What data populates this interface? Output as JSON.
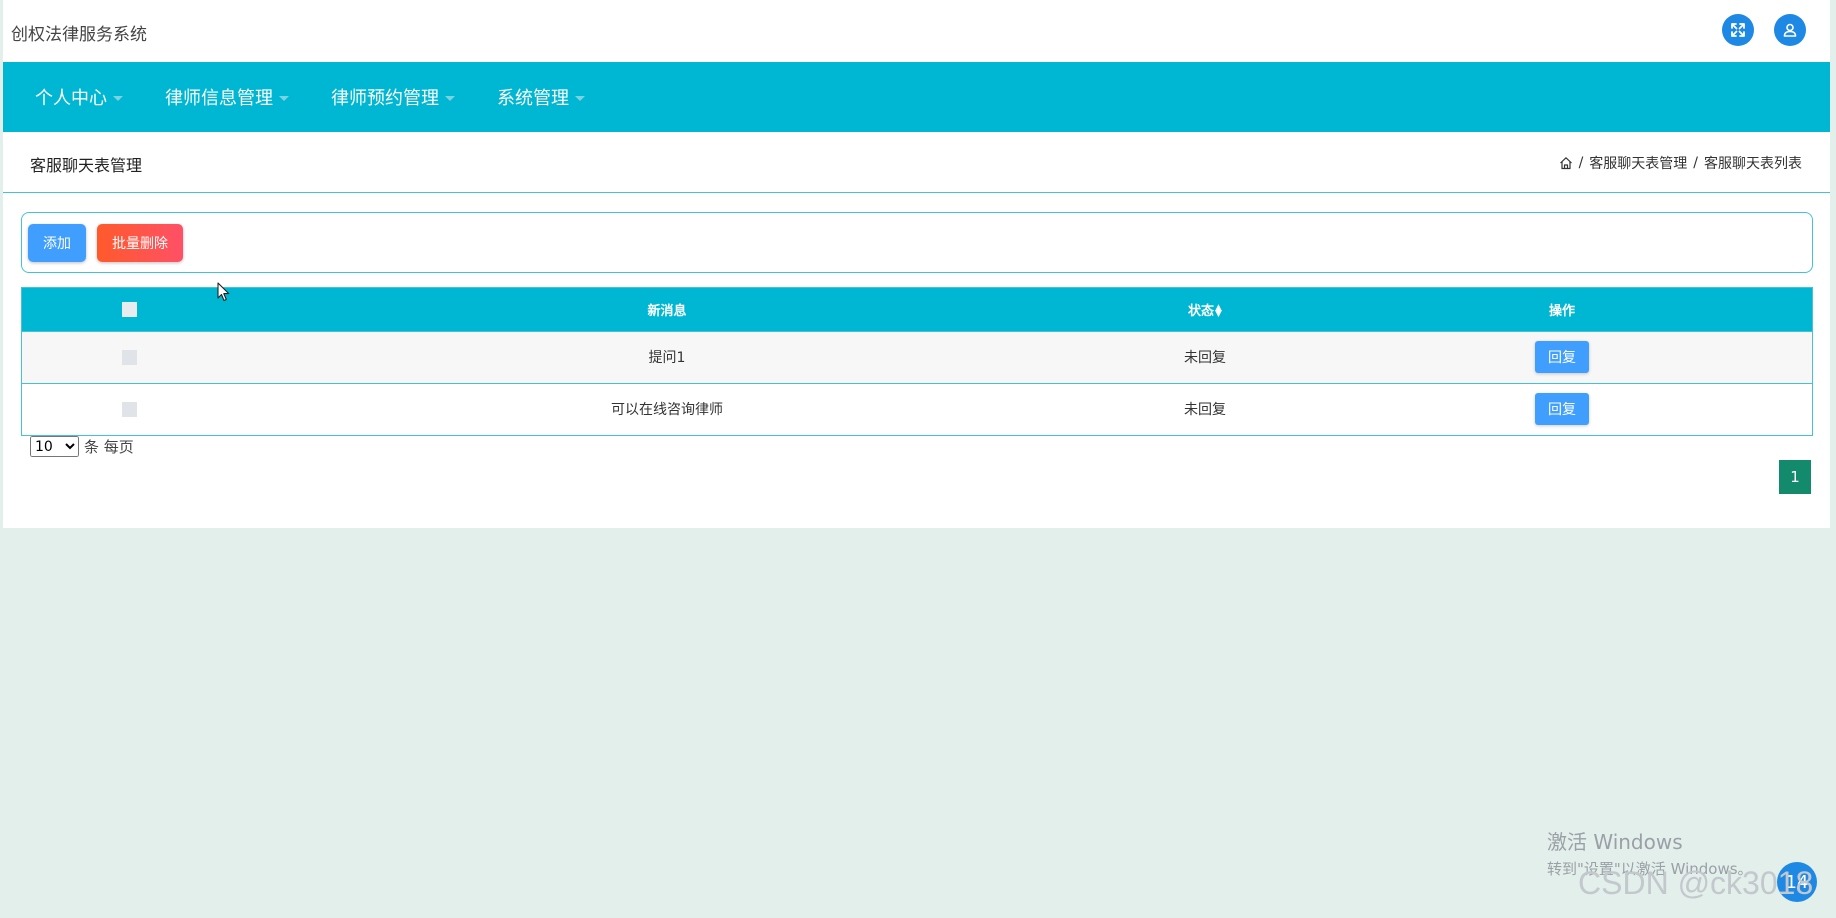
{
  "app": {
    "title": "创权法律服务系统"
  },
  "header": {
    "icons": [
      "fullscreen-icon",
      "user-icon"
    ]
  },
  "nav": {
    "items": [
      {
        "label": "个人中心"
      },
      {
        "label": "律师信息管理"
      },
      {
        "label": "律师预约管理"
      },
      {
        "label": "系统管理"
      }
    ]
  },
  "page": {
    "title": "客服聊天表管理",
    "breadcrumb": [
      "客服聊天表管理",
      "客服聊天表列表"
    ],
    "breadcrumb_sep": "/"
  },
  "toolbar": {
    "add_label": "添加",
    "batch_delete_label": "批量删除"
  },
  "table": {
    "columns": {
      "message": "新消息",
      "status": "状态",
      "actions": "操作"
    },
    "rows": [
      {
        "message": "提问1",
        "status": "未回复",
        "action": "回复"
      },
      {
        "message": "可以在线咨询律师",
        "status": "未回复",
        "action": "回复"
      }
    ]
  },
  "pagination": {
    "page_size": "10",
    "page_size_options": [
      "10"
    ],
    "page_size_suffix": "条 每页",
    "current_page": "1"
  },
  "watermark": {
    "windows_title": "激活 Windows",
    "windows_sub": "转到\"设置\"以激活 Windows。",
    "csdn": "CSDN @ck3018",
    "float_btn": "14"
  },
  "colors": {
    "nav_bg": "#00b7d3",
    "primary": "#409eff",
    "danger": "#ff5066",
    "page_active": "#138a6c",
    "page_bg": "#e3efea"
  }
}
